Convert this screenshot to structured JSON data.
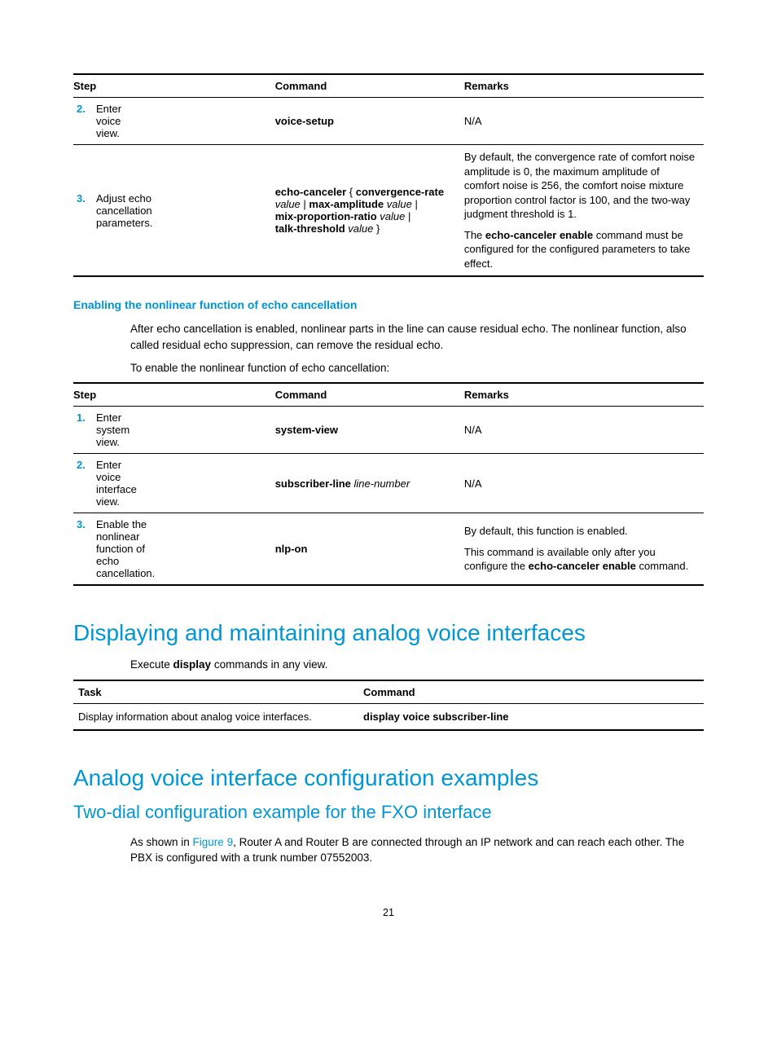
{
  "table1": {
    "headers": {
      "step": "Step",
      "command": "Command",
      "remarks": "Remarks"
    },
    "rows": [
      {
        "num": "2.",
        "desc": "Enter voice view.",
        "cmd_plain": "voice-setup",
        "remarks": "N/A"
      },
      {
        "num": "3.",
        "desc": "Adjust echo cancellation parameters.",
        "cmd": {
          "p1a": "echo-canceler",
          "p1b": " { ",
          "p1c": "convergence-rate",
          "p2a": "value",
          "p2b": " | ",
          "p2c": "max-amplitude",
          "p2d": " ",
          "p2e": "value",
          "p2f": " | ",
          "p3a": "mix-proportion-ratio",
          "p3b": " ",
          "p3c": "value",
          "p3d": " | ",
          "p4a": "talk-threshold",
          "p4b": " ",
          "p4c": "value",
          "p4d": " }"
        },
        "remarks1": "By default, the convergence rate of comfort noise amplitude is 0, the maximum amplitude of comfort noise is 256, the comfort noise mixture proportion control factor is 100, and the two-way judgment threshold is 1.",
        "remarks2a": "The ",
        "remarks2b": "echo-canceler enable",
        "remarks2c": " command must be configured for the configured parameters to take effect."
      }
    ]
  },
  "h4_1": "Enabling the nonlinear function of echo cancellation",
  "para1": "After echo cancellation is enabled, nonlinear parts in the line can cause residual echo. The nonlinear function, also called residual echo suppression, can remove the residual echo.",
  "para2": "To enable the nonlinear function of echo cancellation:",
  "table2": {
    "headers": {
      "step": "Step",
      "command": "Command",
      "remarks": "Remarks"
    },
    "rows": [
      {
        "num": "1.",
        "desc": "Enter system view.",
        "cmd_plain": "system-view",
        "remarks": "N/A"
      },
      {
        "num": "2.",
        "desc": "Enter voice interface view.",
        "cmd_bold": "subscriber-line",
        "cmd_italic": " line-number",
        "remarks": "N/A"
      },
      {
        "num": "3.",
        "desc": "Enable the nonlinear function of echo cancellation.",
        "cmd_plain": "nlp-on",
        "remarks1": "By default, this function is enabled.",
        "remarks2a": "This command is available only after you configure the ",
        "remarks2b": "echo-canceler enable",
        "remarks2c": " command."
      }
    ]
  },
  "h2_1": "Displaying and maintaining analog voice interfaces",
  "para3a": "Execute ",
  "para3b": "display",
  "para3c": " commands in any view.",
  "table3": {
    "headers": {
      "task": "Task",
      "command": "Command"
    },
    "row": {
      "task": "Display information about analog voice interfaces.",
      "command": "display voice subscriber-line"
    }
  },
  "h2_2": "Analog voice interface configuration examples",
  "h3_1": "Two-dial configuration example for the FXO interface",
  "para4a": "As shown in ",
  "para4b": "Figure 9",
  "para4c": ", Router A and Router B are connected through an IP network and can reach each other. The PBX is configured with a trunk number 07552003.",
  "footer": "21"
}
